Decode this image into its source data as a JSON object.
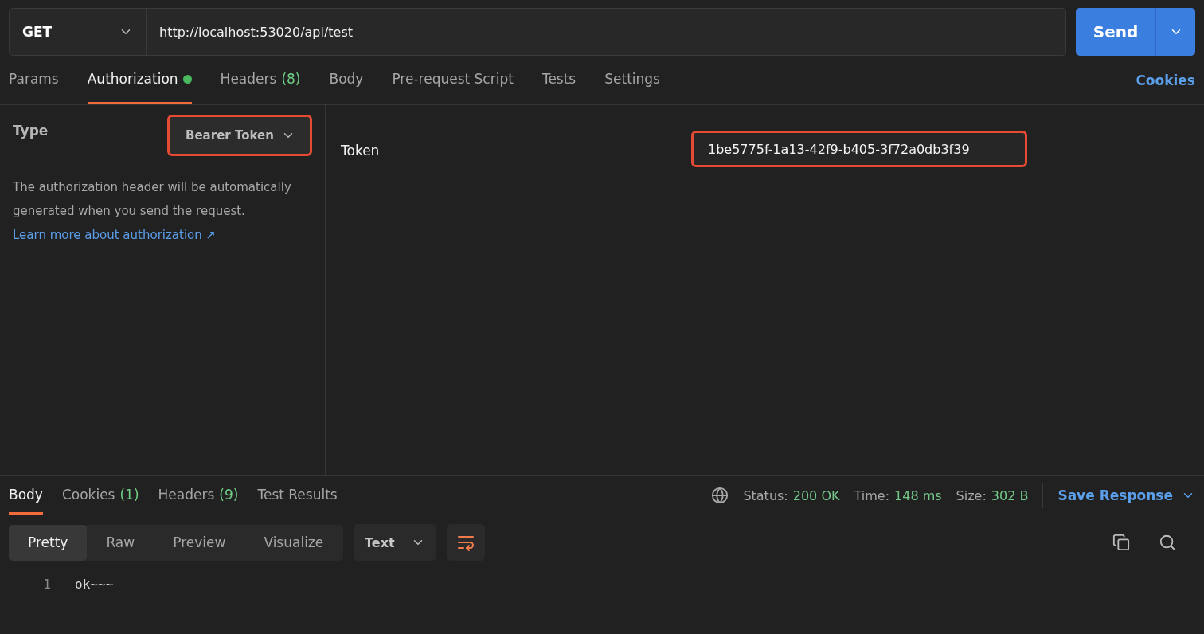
{
  "request": {
    "method": "GET",
    "url": "http://localhost:53020/api/test",
    "send_label": "Send"
  },
  "request_tabs": [
    {
      "label": "Params",
      "selected": false,
      "indicator": false
    },
    {
      "label": "Authorization",
      "selected": true,
      "indicator": true
    },
    {
      "label": "Headers",
      "count": "(8)",
      "selected": false,
      "indicator": false
    },
    {
      "label": "Body",
      "selected": false,
      "indicator": false
    },
    {
      "label": "Pre-request Script",
      "selected": false,
      "indicator": false
    },
    {
      "label": "Tests",
      "selected": false,
      "indicator": false
    },
    {
      "label": "Settings",
      "selected": false,
      "indicator": false
    }
  ],
  "cookies_link": "Cookies",
  "auth": {
    "type_label": "Type",
    "type_value": "Bearer Token",
    "type_highlighted": true,
    "description": "The authorization header will be automatically generated when you send the request.",
    "link": "Learn more about authorization ↗",
    "token_label": "Token",
    "token_value": "1be5775f-1a13-42f9-b405-3f72a0db3f39",
    "token_highlighted": true
  },
  "response_tabs": [
    {
      "label": "Body",
      "selected": true
    },
    {
      "label": "Cookies",
      "count": "(1)",
      "selected": false
    },
    {
      "label": "Headers",
      "count": "(9)",
      "selected": false
    },
    {
      "label": "Test Results",
      "selected": false
    }
  ],
  "response_stats": [
    {
      "label": "Status:",
      "value": "200 OK"
    },
    {
      "label": "Time:",
      "value": "148 ms"
    },
    {
      "label": "Size:",
      "value": "302 B"
    }
  ],
  "save_response": "Save Response",
  "views": [
    {
      "label": "Pretty",
      "selected": true
    },
    {
      "label": "Raw",
      "selected": false
    },
    {
      "label": "Preview",
      "selected": false
    },
    {
      "label": "Visualize",
      "selected": false
    }
  ],
  "format": "Text",
  "code_lines": [
    {
      "number": "1",
      "text": "ok~~~"
    }
  ]
}
